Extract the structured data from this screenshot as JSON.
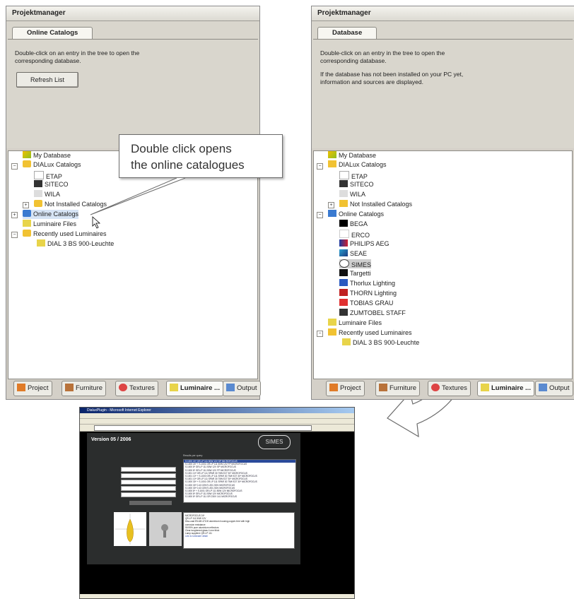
{
  "callout": {
    "line1": "Double click opens",
    "line2": "the online catalogues"
  },
  "left": {
    "title": "Projektmanager",
    "tab": "Online Catalogs",
    "desc1": "Double-click on an entry in the tree to open the",
    "desc2": "corresponding database.",
    "refresh": "Refresh List",
    "tree": [
      "My Database",
      "DIALux Catalogs",
      "ETAP",
      "SITECO",
      "WILA",
      "Not Installed Catalogs",
      "Online Catalogs",
      "Luminaire Files",
      "Recently used Luminaires",
      "DIAL 3 BS 900-Leuchte"
    ]
  },
  "right": {
    "title": "Projektmanager",
    "tab": "Database",
    "desc1": "Double-click on an entry in the tree to open the",
    "desc2": "corresponding database.",
    "desc3": "If the database has not been installed on your PC yet,",
    "desc4": "information and sources are displayed.",
    "tree": [
      "My Database",
      "DIALux Catalogs",
      "ETAP",
      "SITECO",
      "WILA",
      "Not Installed Catalogs",
      "Online Catalogs",
      "BEGA",
      "ERCO",
      "PHILIPS AEG",
      "SEAE",
      "SIMES",
      "Targetti",
      "Thorlux Lighting",
      "THORN Lighting",
      "TOBIAS GRAU",
      "ZUMTOBEL STAFF",
      "Luminaire Files",
      "Recently used Luminaires",
      "DIAL 3 BS 900-Leuchte"
    ]
  },
  "bottom_tabs": [
    "Project",
    "Furniture",
    "Textures",
    "Luminaire ...",
    "Output"
  ],
  "browser": {
    "title": "DialuxPlugin - Microsoft Internet Explorer",
    "version": "Version 05 / 2006",
    "logo": "SIMES",
    "res_header": "Results per query",
    "results": [
      "S.1000 24* GR.LP 111 50W 12V SP MICROFOCUS",
      "S.1000 24* + S.1001 GR.LP 111 50W 12V FP MICROFOCUS",
      "S.1000 8* GR.LP 111 50W 12V SP MICROFOCUS",
      "S.1000 8* GR.LP 111 50W 12V FP MICROFOCUS",
      "S.1001 10* GR.LP 111 SPAR 30 75W E27 30* MICROFOCUS",
      "S.1001 10* + S.1000 GR.LP 111 SPAR 30 75W E27 30* MICROFOCUS",
      "S.1001 10* GR.LP 111 SPAR 30 75W E27 30* MICROFOCUS",
      "S.1000 30* + S.1001 GR.LP 111 SPAR 30 75W E27 30* MICROFOCUS",
      "S.1000 30* 0.43 CENT.LED 230V MICROFOCUS",
      "S.1000 30* 0.43 CENT.LED 230V MICROFOCUS",
      "S.1000 8* + S.1001 GR.LP 111 50W 12V MICROFOCUS",
      "S.1000 8* GR.LP 111 50W 12V MICROFOCUS",
      "S.1000 8* GR.LP 111 GR 230V 141 MICROFOCUS"
    ],
    "detail": [
      "MICROFOCUS 24*",
      "QR-LP 111 50W 12V",
      "",
      "Disc-cast EN AB 47100 aluminium housing,copper-free with high",
      "corrosion resistance",
      "99.99% pure aluminium reflectors",
      "Clear toughened glass 4 mm thick",
      "Lamp supplied: QR-LP 111"
    ],
    "detail_link": "Link to luminaire detail"
  }
}
